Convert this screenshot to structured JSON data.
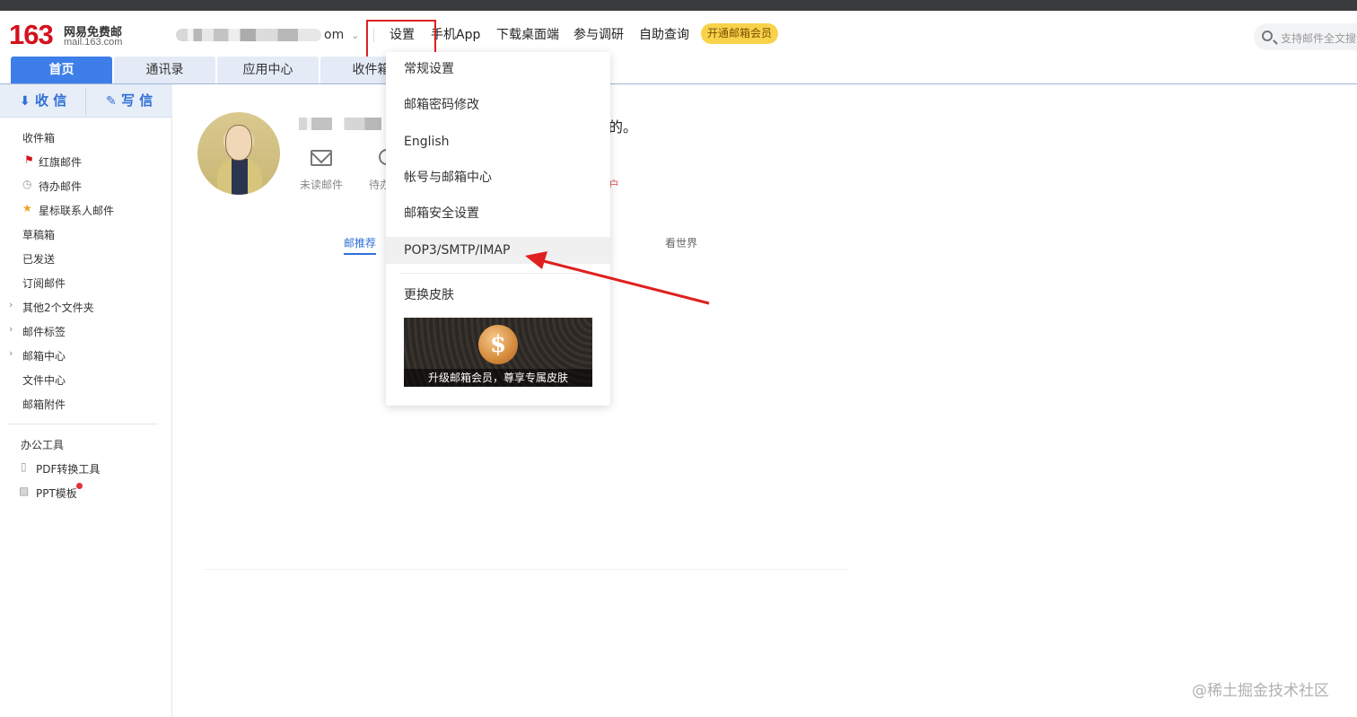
{
  "logo": {
    "number": "163",
    "brand": "网易免费邮",
    "domain": "mail.163.com"
  },
  "account": {
    "visible_suffix": "om",
    "caret": "⌄"
  },
  "topnav": {
    "settings": "设置",
    "mobile_app": "手机App",
    "desktop": "下载桌面端",
    "survey": "参与调研",
    "self_service": "自助查询",
    "vip": "开通邮箱会员"
  },
  "search": {
    "placeholder": "支持邮件全文搜索"
  },
  "tabs": [
    {
      "label": "首页",
      "active": true
    },
    {
      "label": "通讯录"
    },
    {
      "label": "应用中心"
    },
    {
      "label": "收件箱"
    }
  ],
  "sidebar": {
    "receive": "收 信",
    "write": "写 信",
    "items": [
      "收件箱",
      "红旗邮件",
      "待办邮件",
      "星标联系人邮件",
      "草稿箱",
      "已发送",
      "订阅邮件",
      "其他2个文件夹",
      "邮件标签",
      "邮箱中心",
      "文件中心",
      "邮箱附件"
    ],
    "tools_title": "办公工具",
    "tools": [
      "PDF转换工具",
      "PPT模板"
    ]
  },
  "main": {
    "greeting_tail": "的。",
    "unread_label": "未读邮件",
    "todo_label": "待办",
    "red_fragment": "户",
    "feed_tabs": {
      "recommend": "邮推荐",
      "world": "看世界"
    }
  },
  "settings_menu": {
    "items": [
      "常规设置",
      "邮箱密码修改",
      "English",
      "帐号与邮箱中心",
      "邮箱安全设置",
      "POP3/SMTP/IMAP",
      "更换皮肤"
    ],
    "banner_text": "升级邮箱会员，尊享专属皮肤"
  },
  "watermark": "@稀土掘金技术社区",
  "colors": {
    "brand_red": "#d4111d",
    "accent_blue": "#3d7ee8",
    "vip_yellow": "#f8d24a",
    "annotation_red": "#e02020"
  }
}
